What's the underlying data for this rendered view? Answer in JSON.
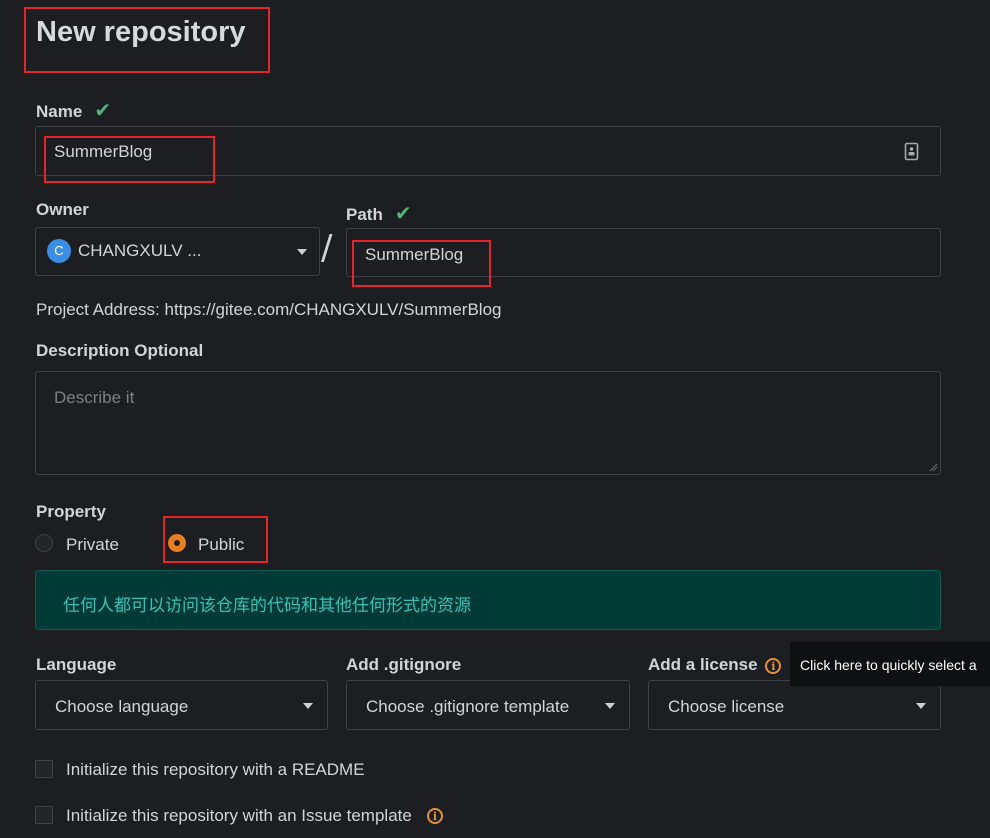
{
  "page": {
    "title": "New repository"
  },
  "name": {
    "label": "Name",
    "value": "SummerBlog"
  },
  "owner": {
    "label": "Owner",
    "avatar_letter": "C",
    "value": "CHANGXULV ..."
  },
  "path": {
    "separator": "/",
    "label": "Path",
    "value": "SummerBlog"
  },
  "project_address": "Project Address: https://gitee.com/CHANGXULV/SummerBlog",
  "description": {
    "label": "Description Optional",
    "placeholder": "Describe it"
  },
  "property": {
    "label": "Property",
    "options": [
      {
        "label": "Private",
        "selected": false
      },
      {
        "label": "Public",
        "selected": true
      }
    ],
    "notice": "任何人都可以访问该仓库的代码和其他任何形式的资源"
  },
  "language": {
    "label": "Language",
    "value": "Choose language"
  },
  "gitignore": {
    "label": "Add .gitignore",
    "value": "Choose .gitignore template"
  },
  "license": {
    "label": "Add a license",
    "value": "Choose license",
    "tooltip": "Click here to quickly select a"
  },
  "init": {
    "readme": "Initialize this repository with a README",
    "issue_template": "Initialize this repository with an Issue template"
  },
  "icons": {
    "info": "i",
    "check": "✔"
  },
  "colors": {
    "accent": "#e67e22",
    "success": "#57b37c",
    "notice_bg": "#003a37",
    "notice_text": "#3ec1b2",
    "highlight": "#e3262a"
  }
}
